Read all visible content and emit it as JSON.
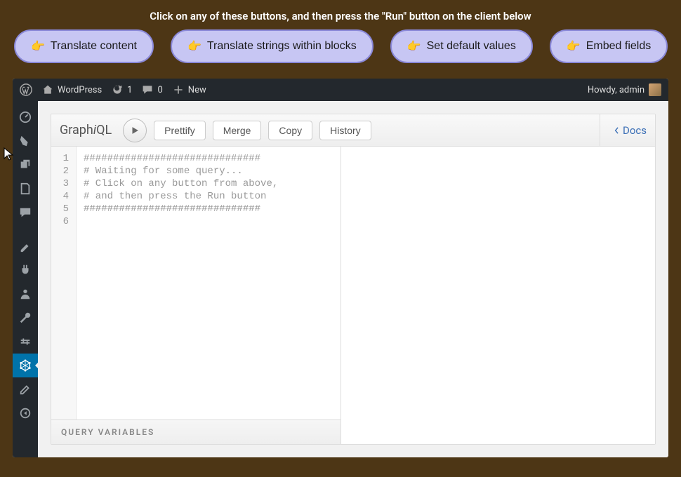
{
  "instruction": "Click on any of these buttons, and then press the \"Run\" button on the client below",
  "pills": [
    "Translate content",
    "Translate strings within blocks",
    "Set default values",
    "Embed fields"
  ],
  "adminbar": {
    "site": "WordPress",
    "updates": "1",
    "comments": "0",
    "new": "New",
    "greeting": "Howdy, admin"
  },
  "graphiql": {
    "logo_prefix": "Graph",
    "logo_i": "i",
    "logo_suffix": "QL",
    "prettify": "Prettify",
    "merge": "Merge",
    "copy": "Copy",
    "history": "History",
    "docs": "Docs",
    "query_variables": "QUERY VARIABLES",
    "lines": [
      "##############################",
      "# Waiting for some query...",
      "# Click on any button from above,",
      "# and then press the Run button",
      "##############################",
      ""
    ]
  }
}
